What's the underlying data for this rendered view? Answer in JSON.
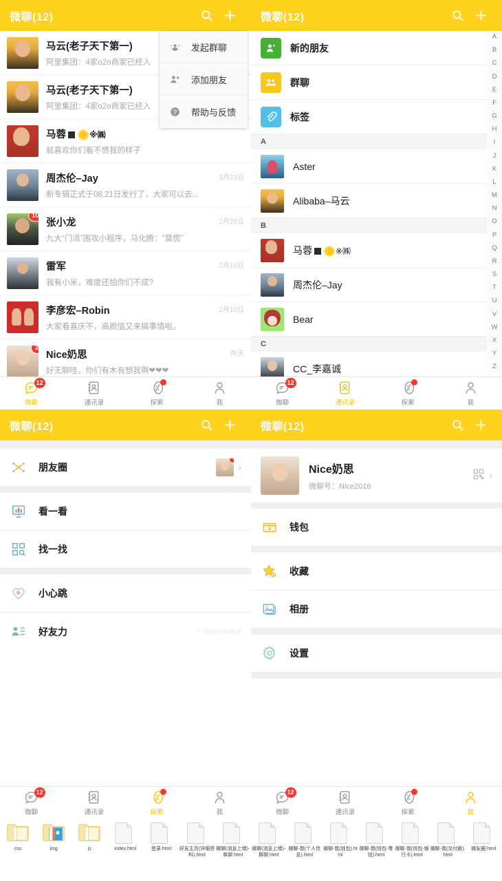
{
  "brand": {
    "header_bg": "#ffd21e",
    "accent": "#f5c300",
    "badge_red": "#f5372f"
  },
  "header": {
    "title": "微聊(12)",
    "search_icon": "search-icon",
    "plus_icon": "plus-icon"
  },
  "popup": {
    "items": [
      {
        "label": "发起群聊",
        "icon": "group-chat-icon"
      },
      {
        "label": "添加朋友",
        "icon": "add-friend-icon"
      },
      {
        "label": "帮助与反馈",
        "icon": "help-icon"
      }
    ]
  },
  "chats": [
    {
      "name": "马云(老子天下第一)",
      "message": "阿里集团：4家o2o商家已经入",
      "time": "",
      "badge": "",
      "avatar": "a-jack"
    },
    {
      "name": "马云(老子天下第一)",
      "message": "阿里集团：4家o2o商家已经入",
      "time": "",
      "badge": "",
      "avatar": "a-jack"
    },
    {
      "name": "马蓉",
      "name_suffix": "※㈱",
      "message": "就喜欢你们看不惯我的样子",
      "time": "",
      "badge": "",
      "avatar": "a-marong"
    },
    {
      "name": "周杰伦–Jay",
      "message": "新专辑正式于08.21日发行了，大家可以去...",
      "time": "3月23日",
      "badge": "",
      "avatar": "a-jay"
    },
    {
      "name": "张小龙",
      "message": "九大“门派”围攻小程序，马化腾：“莫慌”",
      "time": "2月28日",
      "badge": "10",
      "avatar": "a-zxl"
    },
    {
      "name": "雷军",
      "message": "我有小米，难度还怕你们不成?",
      "time": "2月19日",
      "badge": "",
      "avatar": "a-lj"
    },
    {
      "name": "李彦宏–Robin",
      "message": "大家看喜庆不，高颜值又来搞事情啦。",
      "time": "2月15日",
      "badge": "",
      "avatar": "a-lyh"
    },
    {
      "name": "Nice奶思",
      "message": "好无聊哇，你们有木有想我啊❤❤❤",
      "time": "昨天",
      "badge": "2",
      "avatar": "a-nice"
    }
  ],
  "contacts": {
    "entries": [
      {
        "label": "新的朋友",
        "icon": "new-friend-icon",
        "color": "#45b035"
      },
      {
        "label": "群聊",
        "icon": "group-chat-icon",
        "color": "#f5c81e"
      },
      {
        "label": "标签",
        "icon": "tag-icon",
        "color": "#53bfe8"
      }
    ],
    "sections": [
      {
        "letter": "A",
        "people": [
          {
            "name": "Aster",
            "avatar": "a-aster"
          },
          {
            "name": "Alibaba–马云",
            "avatar": "a-jack"
          }
        ]
      },
      {
        "letter": "B",
        "people": [
          {
            "name": "马蓉",
            "name_suffix": "※㈱",
            "avatar": "a-marong"
          },
          {
            "name": "周杰伦–Jay",
            "avatar": "a-jay"
          },
          {
            "name": "Bear",
            "avatar": "a-bear"
          }
        ]
      },
      {
        "letter": "C",
        "people": [
          {
            "name": "CC_李嘉诚",
            "avatar": "a-cc"
          }
        ]
      }
    ],
    "index_letters": [
      "A",
      "B",
      "C",
      "D",
      "E",
      "F",
      "G",
      "H",
      "I",
      "J",
      "K",
      "L",
      "M",
      "N",
      "O",
      "P",
      "Q",
      "R",
      "S",
      "T",
      "U",
      "V",
      "W",
      "X",
      "Y",
      "Z"
    ]
  },
  "discover": {
    "groups": [
      [
        {
          "label": "朋友圈",
          "icon": "moments-icon",
          "thumb": true,
          "badge_dot": true,
          "chevron": "›"
        }
      ],
      [
        {
          "label": "看一看",
          "icon": "look-icon"
        },
        {
          "label": "找一找",
          "icon": "scan-search-icon"
        }
      ],
      [
        {
          "label": "小心跳",
          "icon": "heartbeat-icon"
        },
        {
          "label": "好友力",
          "icon": "friend-power-icon",
          "sub": "^-^我相信有奇迹"
        }
      ]
    ]
  },
  "me": {
    "profile": {
      "name": "Nice奶思",
      "id_label": "微聊号：Nice2018",
      "qr_icon": "qr-code-icon",
      "chevron": "›",
      "avatar": "a-nice"
    },
    "groups": [
      [
        {
          "label": "钱包",
          "icon": "wallet-icon"
        }
      ],
      [
        {
          "label": "收藏",
          "icon": "favorites-icon"
        },
        {
          "label": "相册",
          "icon": "album-icon"
        }
      ],
      [
        {
          "label": "设置",
          "icon": "settings-icon"
        }
      ]
    ]
  },
  "tabs": {
    "items": [
      {
        "label": "微聊",
        "icon": "chat-icon",
        "badge": "12",
        "dot": false
      },
      {
        "label": "通讯录",
        "icon": "contacts-icon",
        "badge": "",
        "dot": false
      },
      {
        "label": "探索",
        "icon": "discover-icon",
        "badge": "",
        "dot": true
      },
      {
        "label": "我",
        "icon": "profile-icon",
        "badge": "",
        "dot": false
      }
    ],
    "active": {
      "chats": 0,
      "contacts": 1,
      "discover": 2,
      "me": 3
    }
  },
  "files": [
    {
      "name": "css",
      "type": "folder"
    },
    {
      "name": "img",
      "type": "folder-open"
    },
    {
      "name": "js",
      "type": "folder"
    },
    {
      "name": "index.html",
      "type": "file"
    },
    {
      "name": "登录.html",
      "type": "file"
    },
    {
      "name": "好友主页(详细资料).html",
      "type": "file"
    },
    {
      "name": "微聊(消息上墙)-单聊.html",
      "type": "file"
    },
    {
      "name": "微聊(消息上墙)-群聊.html",
      "type": "file"
    },
    {
      "name": "微聊-我(个人信息).html",
      "type": "file"
    },
    {
      "name": "微聊-我(钱包).html",
      "type": "file"
    },
    {
      "name": "微聊-我(钱包-零钱).html",
      "type": "file"
    },
    {
      "name": "微聊-我(钱包-银行卡).html",
      "type": "file"
    },
    {
      "name": "微聊-我(交付款).html",
      "type": "file"
    },
    {
      "name": "微友圈.html",
      "type": "file"
    }
  ]
}
